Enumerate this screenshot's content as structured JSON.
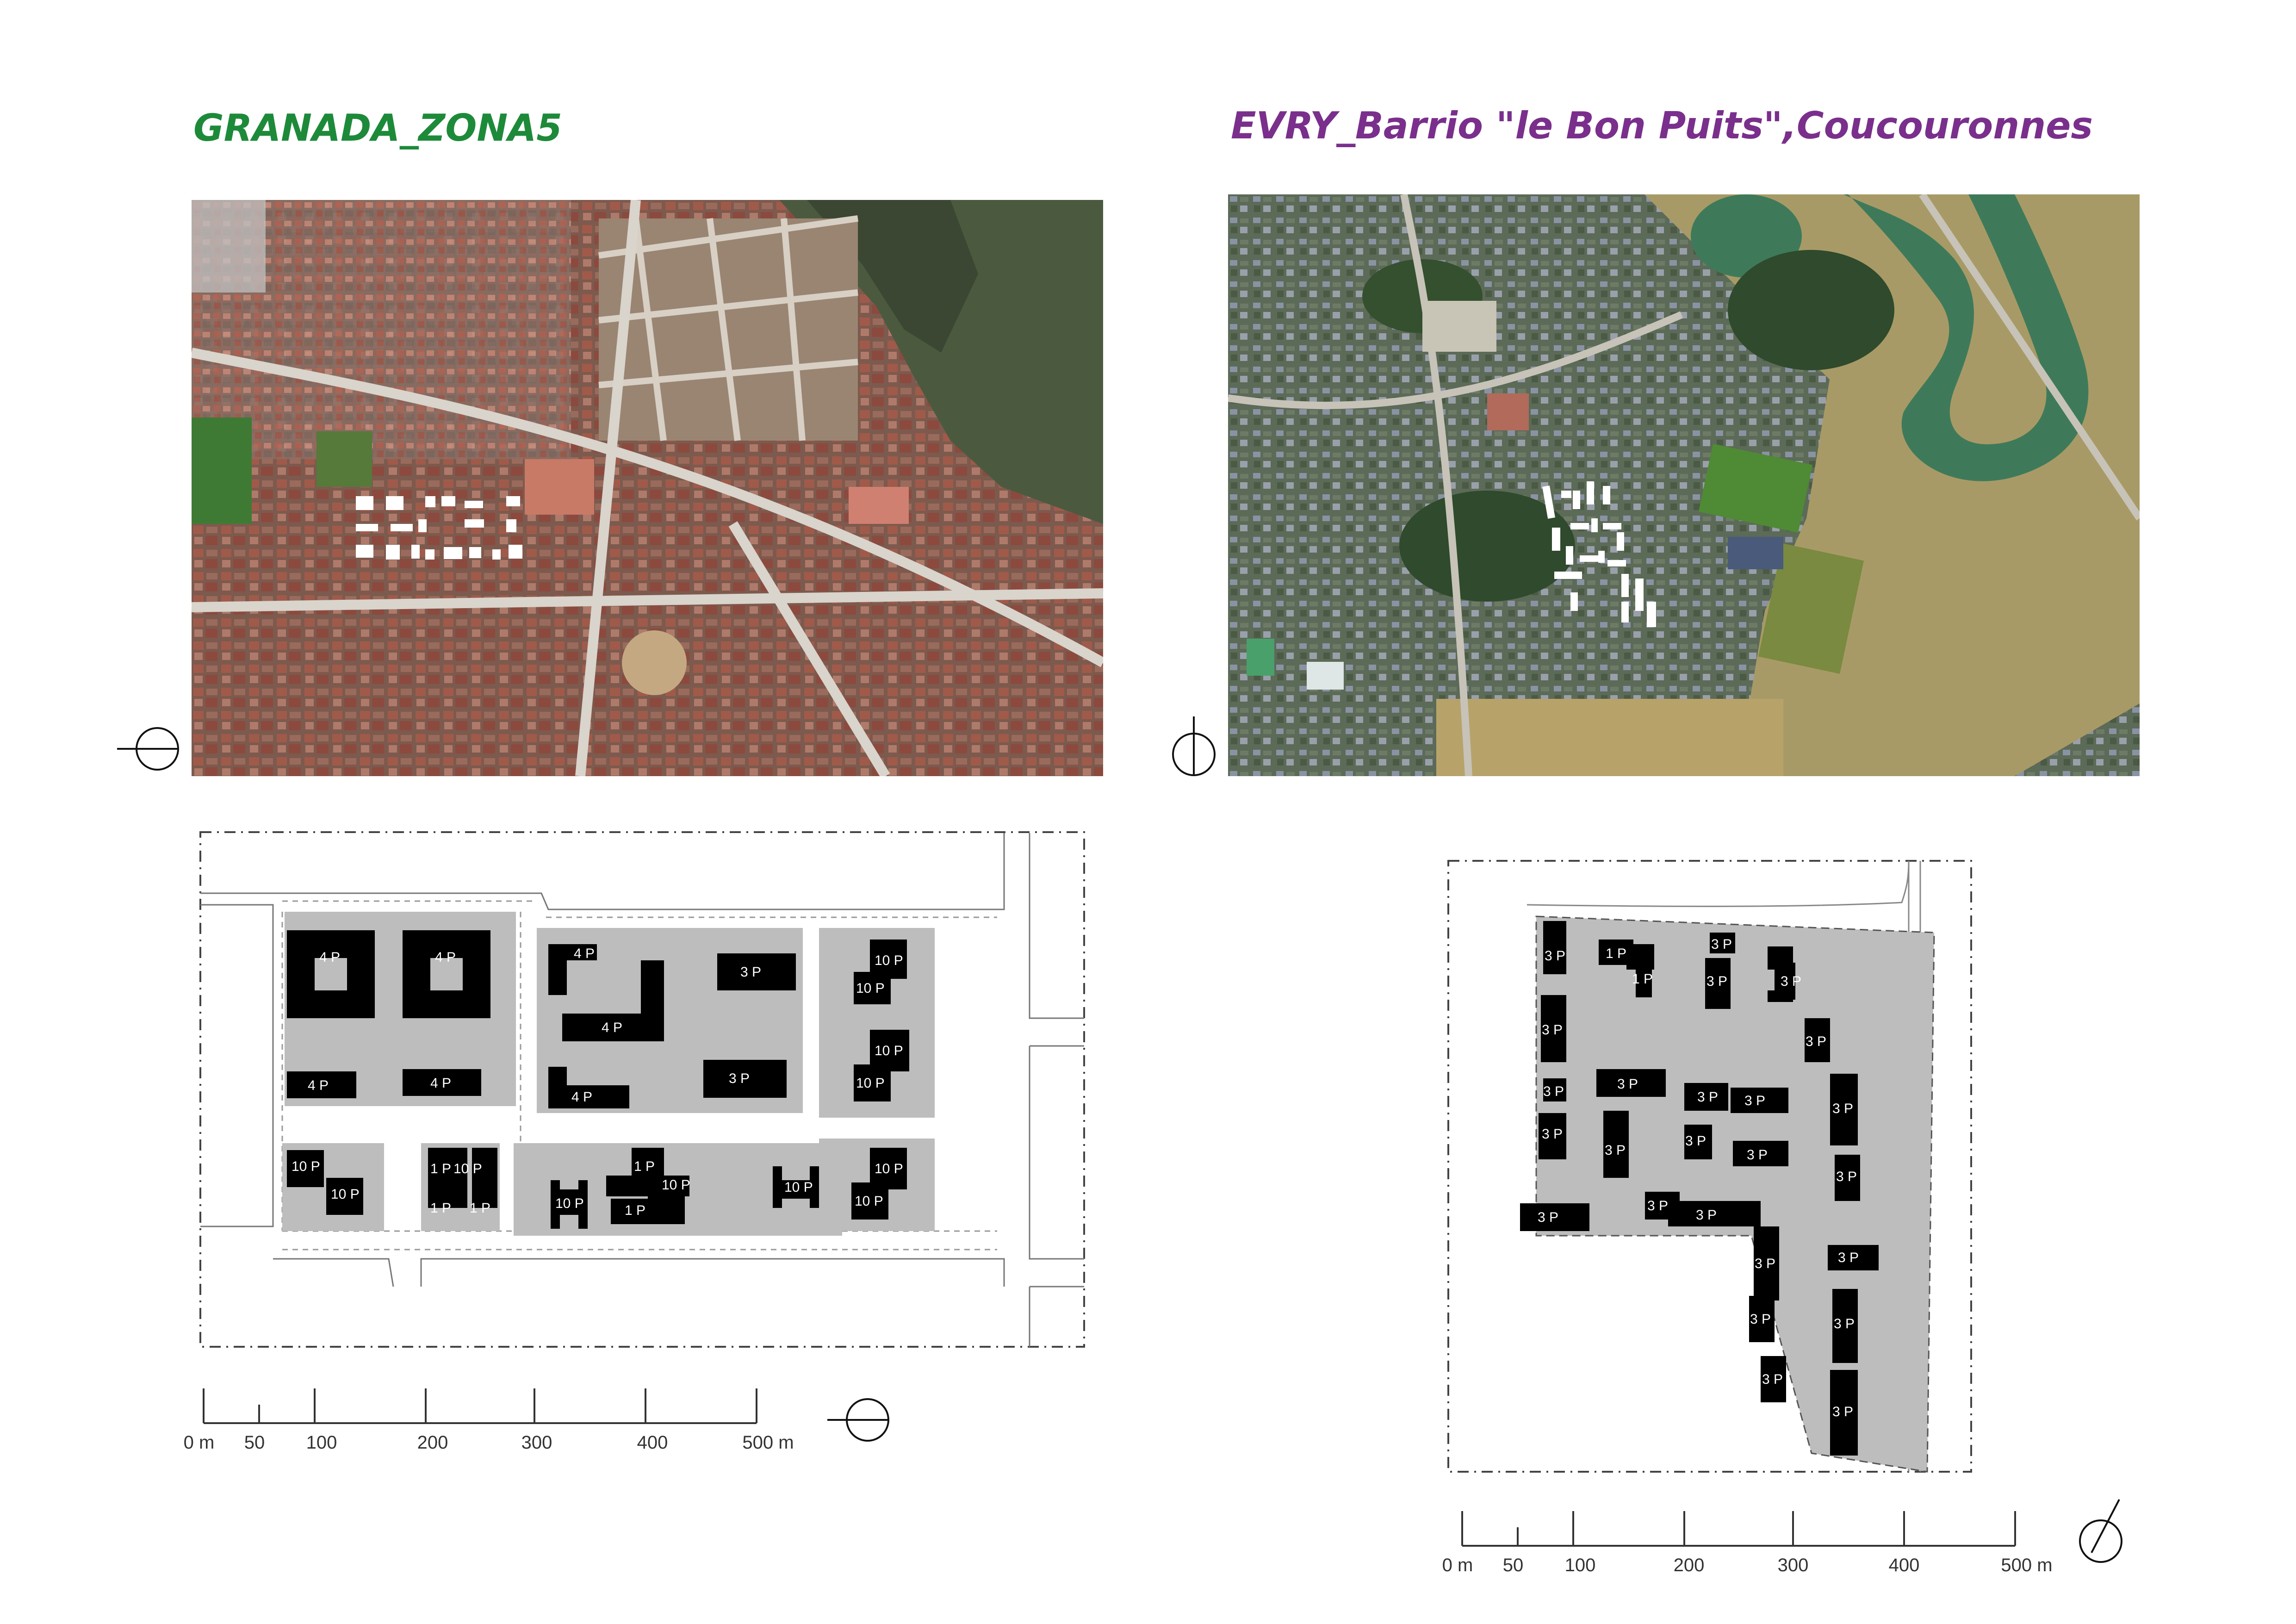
{
  "left": {
    "title": "GRANADA_ZONA5",
    "title_color": "#1d8a3a",
    "aerial_alt": "Aerial view of Granada Zona 5",
    "scale": {
      "ticks": [
        "0 m",
        "50",
        "100",
        "200",
        "300",
        "400",
        "500 m"
      ]
    },
    "labels": {
      "floors_4": "4 P",
      "floors_3": "3 P",
      "floors_10": "10 P",
      "floors_1": "1 P"
    }
  },
  "right": {
    "title": "EVRY_Barrio \"le Bon Puits\",Coucouronnes",
    "title_color": "#7a2f8c",
    "aerial_alt": "Aerial view of Evry, le Bon Puits",
    "scale": {
      "ticks": [
        "0 m",
        "50",
        "100",
        "200",
        "300",
        "400",
        "500 m"
      ]
    },
    "labels": {
      "floors_3": "3 P",
      "floors_1": "1 P"
    }
  },
  "colors": {
    "block_fill": "#bdbdbd",
    "building_fill": "#000000",
    "urban_aerial": "#8a6a5e",
    "suburb_aerial": "#5b6a55",
    "lake": "#3e7a5a",
    "field": "#6a8a3a"
  },
  "icons": [
    "north-arrow-icon"
  ]
}
